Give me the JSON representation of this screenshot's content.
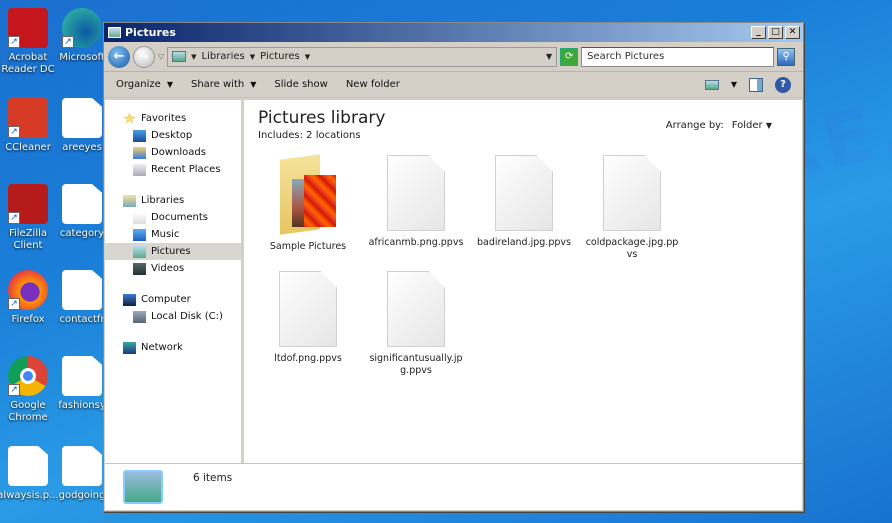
{
  "desktop": {
    "icons": [
      {
        "label": "Acrobat Reader DC",
        "icon": "acrobat-icon",
        "color": "#c4161c"
      },
      {
        "label": "Microsoft",
        "icon": "edge-icon",
        "color": "#1b9de2"
      },
      {
        "label": "CCleaner",
        "icon": "ccleaner-icon",
        "color": "#d63b26"
      },
      {
        "label": "areeyes",
        "icon": "file-icon",
        "color": "#ffffff"
      },
      {
        "label": "FileZilla Client",
        "icon": "filezilla-icon",
        "color": "#b51b1b"
      },
      {
        "label": "category",
        "icon": "file-icon",
        "color": "#ffffff"
      },
      {
        "label": "Firefox",
        "icon": "firefox-icon",
        "color": "#e66000"
      },
      {
        "label": "contactfr",
        "icon": "file-icon",
        "color": "#ffffff"
      },
      {
        "label": "Google Chrome",
        "icon": "chrome-icon",
        "color": "#4285f4"
      },
      {
        "label": "fashionsy",
        "icon": "file-icon",
        "color": "#ffffff"
      },
      {
        "label": "alwaysis.p...",
        "icon": "file-icon",
        "color": "#ffffff"
      },
      {
        "label": "godgoing",
        "icon": "file-icon",
        "color": "#ffffff"
      }
    ]
  },
  "window": {
    "title": "Pictures",
    "buttons": {
      "minimize": "_",
      "maximize": "□",
      "close": "✕"
    },
    "address": {
      "crumbs": [
        "Libraries",
        "Pictures"
      ],
      "separator": "▸"
    },
    "search": {
      "placeholder": "Search Pictures"
    },
    "commands": [
      {
        "label": "Organize",
        "dropdown": true
      },
      {
        "label": "Share with",
        "dropdown": true
      },
      {
        "label": "Slide show",
        "dropdown": false
      },
      {
        "label": "New folder",
        "dropdown": false
      }
    ]
  },
  "nav": {
    "groups": [
      {
        "label": "Favorites",
        "icon": "star-icon",
        "items": [
          {
            "label": "Desktop",
            "icon": "desktop-icon"
          },
          {
            "label": "Downloads",
            "icon": "downloads-icon"
          },
          {
            "label": "Recent Places",
            "icon": "recent-places-icon"
          }
        ]
      },
      {
        "label": "Libraries",
        "icon": "libraries-icon",
        "items": [
          {
            "label": "Documents",
            "icon": "documents-icon"
          },
          {
            "label": "Music",
            "icon": "music-icon"
          },
          {
            "label": "Pictures",
            "icon": "pictures-icon",
            "selected": true
          },
          {
            "label": "Videos",
            "icon": "videos-icon"
          }
        ]
      },
      {
        "label": "Computer",
        "icon": "computer-icon",
        "items": [
          {
            "label": "Local Disk (C:)",
            "icon": "disk-icon"
          }
        ]
      },
      {
        "label": "Network",
        "icon": "network-icon",
        "items": []
      }
    ]
  },
  "library": {
    "title": "Pictures library",
    "subtitle": "Includes:  2 locations",
    "arrange_label": "Arrange by:",
    "arrange_value": "Folder"
  },
  "files": [
    {
      "name": "Sample Pictures",
      "type": "folder"
    },
    {
      "name": "africanmb.png.ppvs",
      "type": "file"
    },
    {
      "name": "badireland.jpg.ppvs",
      "type": "file"
    },
    {
      "name": "coldpackage.jpg.ppvs",
      "type": "file"
    },
    {
      "name": "ltdof.png.ppvs",
      "type": "file"
    },
    {
      "name": "significantusually.jpg.ppvs",
      "type": "file"
    }
  ],
  "status": {
    "count": "6 items"
  },
  "watermark": "MYANTISPYWARE.COM"
}
